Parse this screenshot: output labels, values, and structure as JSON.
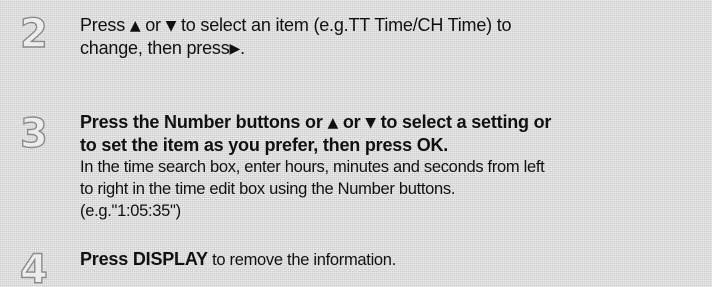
{
  "steps": [
    {
      "number": "2",
      "line1_a": "Press ",
      "up_glyph": "▲",
      "line1_b": " or ",
      "down_glyph": "▼",
      "line1_c": " to select an item (e.g.TT Time/CH Time) to",
      "line2_a": "change, then press",
      "right_glyph": "▶",
      "line2_b": "."
    },
    {
      "number": "3",
      "bold1_a": "Press the Number buttons or ",
      "up_glyph": "▲",
      "bold1_b": " or ",
      "down_glyph": "▼",
      "bold1_c": " to select a setting or",
      "bold2": "to set the item as you prefer, then press OK.",
      "normal1": "In the time search box, enter hours, minutes and seconds from left",
      "normal2": "to right in the time edit box using the Number buttons.",
      "normal3": "(e.g.\"1:05:35\")"
    },
    {
      "number": "4",
      "bold": "Press DISPLAY",
      "rest": " to remove the information."
    }
  ]
}
